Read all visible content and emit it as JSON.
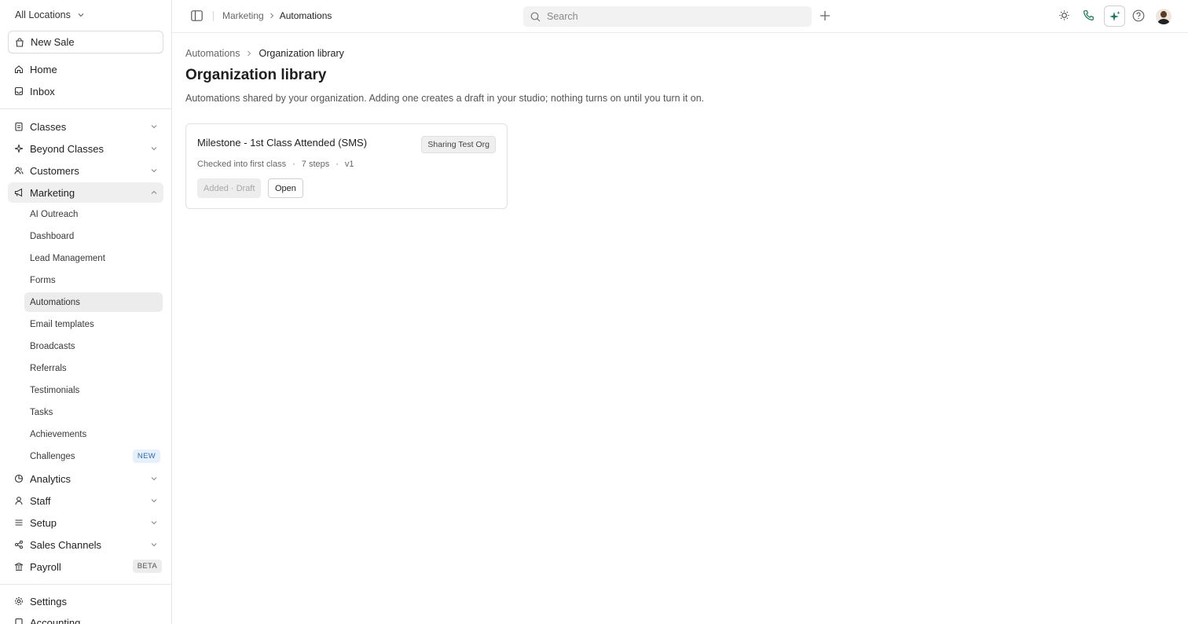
{
  "sidebar": {
    "location": "All Locations",
    "new_sale": "New Sale",
    "home": "Home",
    "inbox": "Inbox",
    "classes": "Classes",
    "beyond_classes": "Beyond Classes",
    "customers": "Customers",
    "marketing": "Marketing",
    "marketing_items": [
      "AI Outreach",
      "Dashboard",
      "Lead Management",
      "Forms",
      "Automations",
      "Email templates",
      "Broadcasts",
      "Referrals",
      "Testimonials",
      "Tasks",
      "Achievements",
      "Challenges"
    ],
    "challenges_badge": "NEW",
    "analytics": "Analytics",
    "staff": "Staff",
    "setup": "Setup",
    "sales_channels": "Sales Channels",
    "payroll": "Payroll",
    "payroll_badge": "BETA",
    "settings": "Settings",
    "accounting": "Accounting"
  },
  "topbar": {
    "crumb_parent": "Marketing",
    "crumb_current": "Automations",
    "search_placeholder": "Search",
    "accent": "#16795b"
  },
  "main": {
    "breadcrumb_parent": "Automations",
    "breadcrumb_current": "Organization library",
    "title": "Organization library",
    "description": "Automations shared by your organization. Adding one creates a draft in your studio; nothing turns on until you turn it on.",
    "card": {
      "title": "Milestone - 1st Class Attended (SMS)",
      "org_badge": "Sharing Test Org",
      "trigger": "Checked into first class",
      "sep": "·",
      "steps": "7 steps",
      "version": "v1",
      "added_button": "Added · Draft",
      "open_button": "Open"
    }
  }
}
